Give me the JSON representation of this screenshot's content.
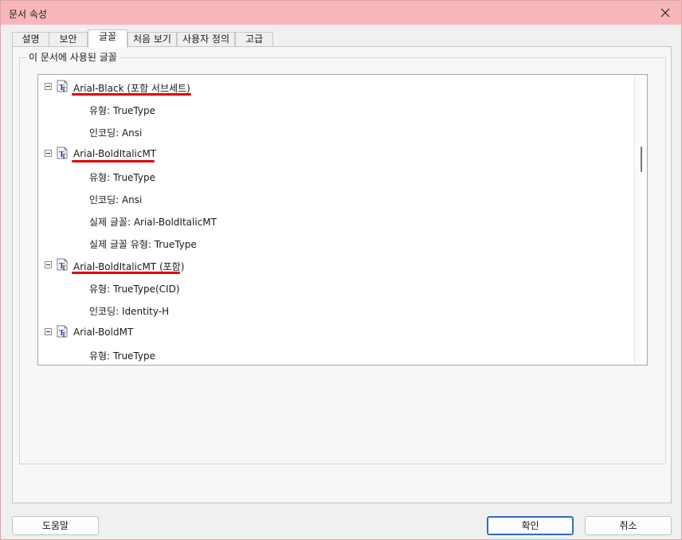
{
  "window": {
    "title": "문서 속성"
  },
  "tabs": [
    {
      "label": "설명",
      "active": false
    },
    {
      "label": "보안",
      "active": false
    },
    {
      "label": "글꼴",
      "active": true
    },
    {
      "label": "처음 보기",
      "active": false
    },
    {
      "label": "사용자 정의",
      "active": false
    },
    {
      "label": "고급",
      "active": false
    }
  ],
  "fonts_group": {
    "label": "이 문서에 사용된 글꼴",
    "fonts": [
      {
        "name": "Arial-Black (포함 서브세트)",
        "highlighted": true,
        "attributes": [
          "유형: TrueType",
          "인코딩: Ansi"
        ]
      },
      {
        "name": "Arial-BoldItalicMT",
        "highlighted": true,
        "attributes": [
          "유형: TrueType",
          "인코딩: Ansi",
          "실제 글꼴: Arial-BoldItalicMT",
          "실제 글꼴 유형: TrueType"
        ]
      },
      {
        "name": "Arial-BoldItalicMT (포함)",
        "highlighted": true,
        "attributes": [
          "유형: TrueType(CID)",
          "인코딩: Identity-H"
        ]
      },
      {
        "name": "Arial-BoldMT",
        "highlighted": false,
        "attributes": [
          "유형: TrueType"
        ]
      }
    ]
  },
  "buttons": {
    "help": "도움말",
    "ok": "확인",
    "cancel": "취소"
  },
  "colors": {
    "titlebar": "#f9b7bb",
    "highlight_underline": "#e00000",
    "primary_button_border": "#2f6dbd"
  },
  "icons": {
    "font_node": "truetype-font-icon",
    "expander": "tree-collapse-icon",
    "close": "close-icon"
  }
}
